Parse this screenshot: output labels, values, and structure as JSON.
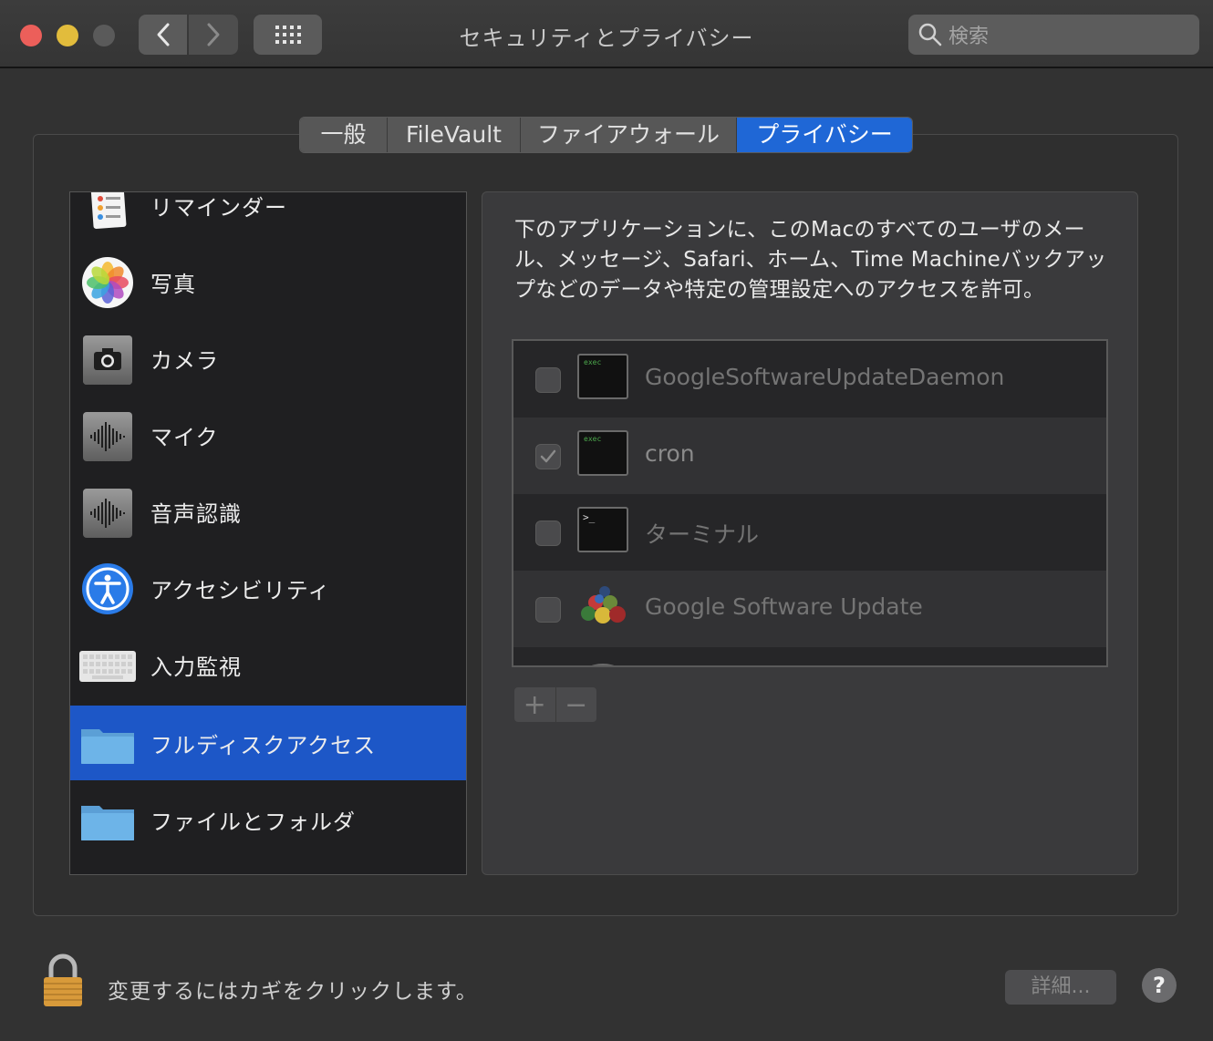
{
  "window": {
    "title": "セキュリティとプライバシー"
  },
  "search": {
    "placeholder": "検索"
  },
  "tabs": [
    {
      "label": "一般"
    },
    {
      "label": "FileVault"
    },
    {
      "label": "ファイアウォール"
    },
    {
      "label": "プライバシー",
      "selected": true
    }
  ],
  "sidebar": {
    "items": [
      {
        "label": "リマインダー",
        "icon": "reminders-icon"
      },
      {
        "label": "写真",
        "icon": "photos-icon"
      },
      {
        "label": "カメラ",
        "icon": "camera-icon"
      },
      {
        "label": "マイク",
        "icon": "microphone-icon"
      },
      {
        "label": "音声認識",
        "icon": "speech-recognition-icon"
      },
      {
        "label": "アクセシビリティ",
        "icon": "accessibility-icon"
      },
      {
        "label": "入力監視",
        "icon": "keyboard-icon"
      },
      {
        "label": "フルディスクアクセス",
        "icon": "folder-icon",
        "selected": true
      },
      {
        "label": "ファイルとフォルダ",
        "icon": "folder-icon"
      }
    ]
  },
  "main": {
    "description": "下のアプリケーションに、このMacのすべてのユーザのメール、メッセージ、Safari、ホーム、Time Machineバックアップなどのデータや特定の管理設定へのアクセスを許可。",
    "apps": [
      {
        "name": "GoogleSoftwareUpdateDaemon",
        "checked": false,
        "icon": "exec-icon",
        "icon_text": "exec"
      },
      {
        "name": "cron",
        "checked": true,
        "icon": "exec-icon",
        "icon_text": "exec"
      },
      {
        "name": "ターミナル",
        "checked": false,
        "icon": "terminal-icon",
        "icon_text": ">_"
      },
      {
        "name": "Google Software Update",
        "checked": false,
        "icon": "google-software-update-icon"
      }
    ],
    "add_label": "+",
    "remove_label": "−"
  },
  "footer": {
    "lock_text": "変更するにはカギをクリックします。",
    "details_label": "詳細...",
    "help_label": "?"
  },
  "colors": {
    "accent": "#1f67d6",
    "selection": "#1d57c7",
    "background": "#323232"
  }
}
